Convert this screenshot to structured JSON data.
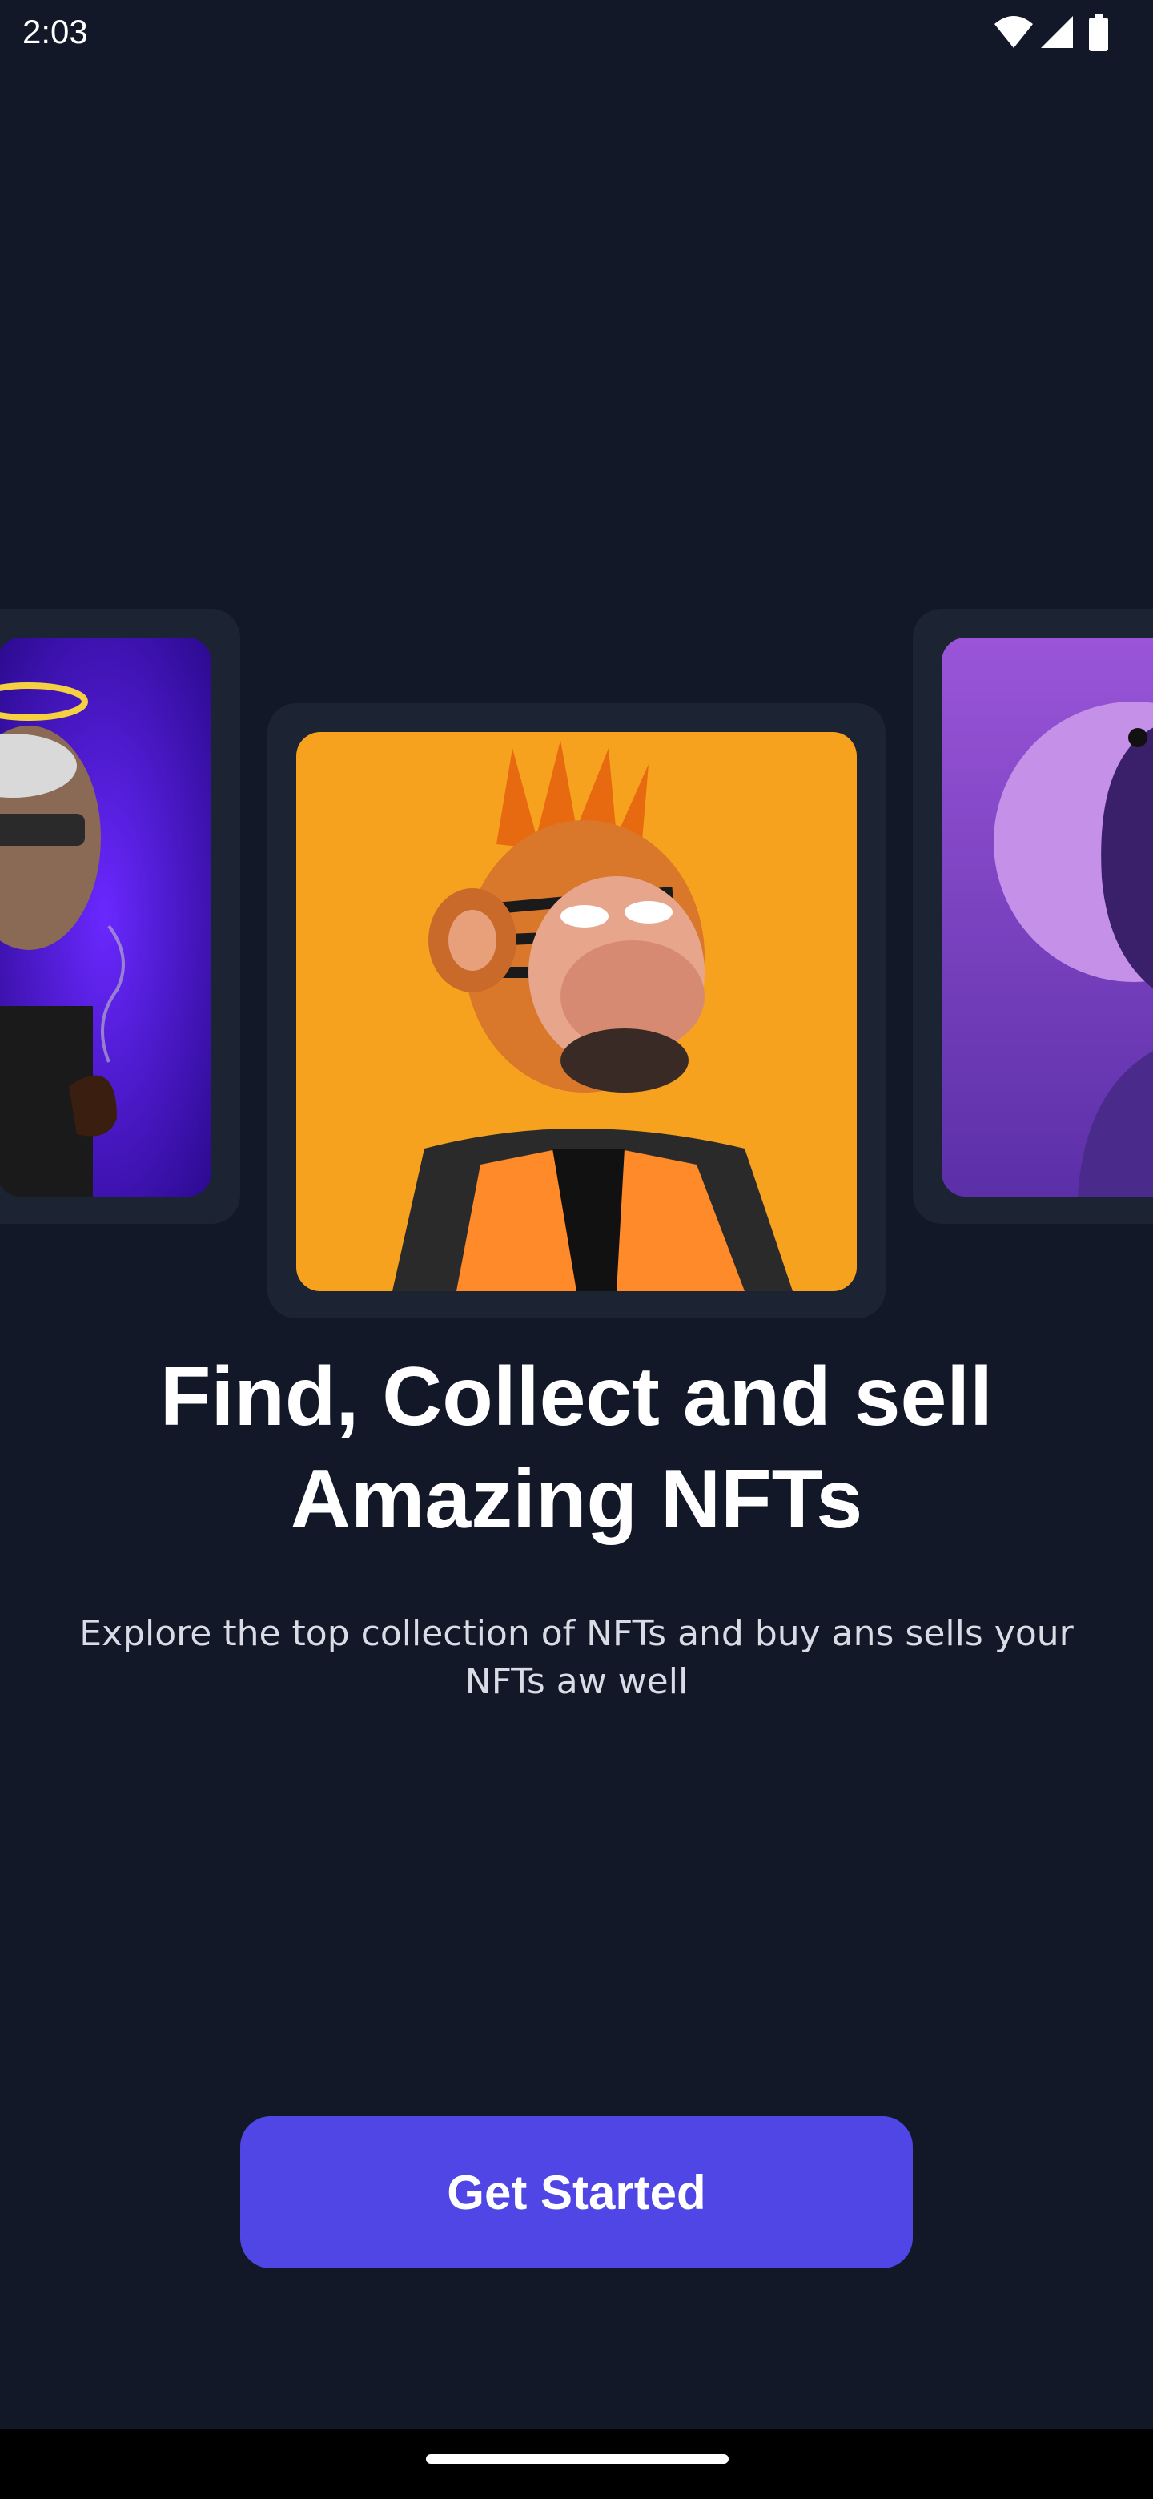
{
  "status_bar": {
    "time": "2:03",
    "icons": [
      "wifi-icon",
      "cellular-signal-icon",
      "battery-icon"
    ]
  },
  "carousel": {
    "cards": [
      {
        "name": "nft-card-left",
        "description_colors": [
          "#3a0fd6",
          "#6a28ff"
        ]
      },
      {
        "name": "nft-card-center",
        "description_colors": [
          "#f5a523",
          "#ff9a1e"
        ]
      },
      {
        "name": "nft-card-right",
        "description_colors": [
          "#8a49d1",
          "#5b2fa8"
        ]
      }
    ]
  },
  "onboarding": {
    "headline": "Find, Collect and sell Amazing NFTs",
    "subtext": "Explore the top collection of NFTs and buy ans sells your NFTs aw well"
  },
  "cta": {
    "label": "Get Started"
  },
  "colors": {
    "background": "#121828",
    "card": "#1c2332",
    "accent": "#4f46e5",
    "text": "#ffffff"
  }
}
